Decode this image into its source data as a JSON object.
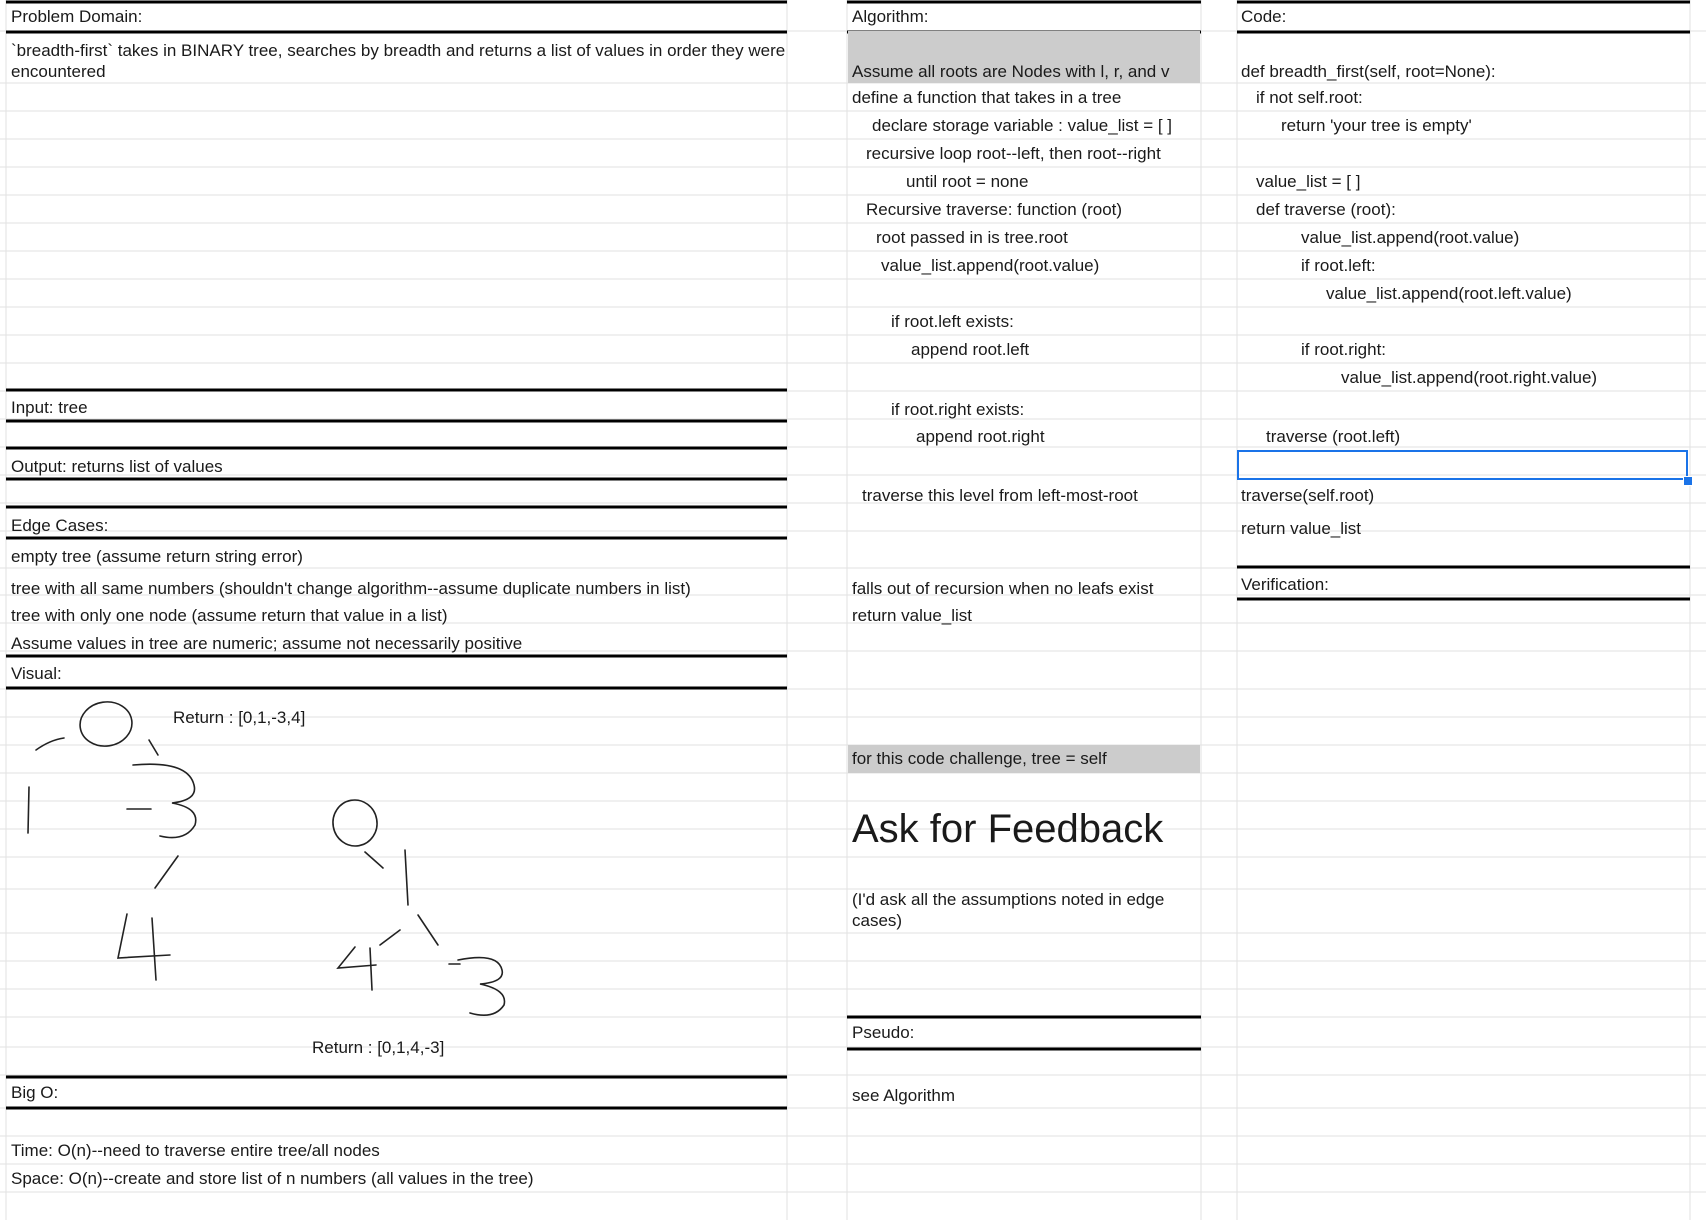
{
  "problem": {
    "header": "Problem Domain:",
    "text": "`breadth-first` takes in BINARY tree, searches by breadth and returns a list of values in order they were encountered",
    "input": "Input:  tree",
    "output": "Output: returns list of values",
    "edge_header": "Edge Cases:",
    "edge_cases": [
      "empty tree (assume return string error)",
      "tree with all same numbers (shouldn't change algorithm--assume duplicate numbers in list)",
      "tree with only one node (assume return that value in a list)",
      "Assume values in tree are numeric; assume not necessarily positive"
    ],
    "visual_header": "Visual:",
    "return1": "Return : [0,1,-3,4]",
    "return2": "Return : [0,1,4,-3]",
    "bigo_header": "Big O:",
    "time": "Time: O(n)--need to traverse entire tree/all nodes",
    "space": "Space: O(n)--create and store list of n numbers (all values in the tree)"
  },
  "algorithm": {
    "header": "Algorithm:",
    "lines": [
      "Assume all roots are Nodes with l, r, and v",
      "define a function that takes in a tree",
      "declare storage variable : value_list = [ ]",
      "recursive loop root--left, then root--right",
      "until root = none",
      "Recursive traverse: function (root)",
      "root passed in is tree.root",
      "value_list.append(root.value)",
      "if root.left exists:",
      "append root.left",
      "if root.right exists:",
      "append root.right",
      "traverse this level from left-most-root",
      "falls out of recursion when no leafs exist",
      "return value_list"
    ],
    "note": "for this code challenge, tree = self",
    "feedback": "Ask for Feedback",
    "feedback_note": "(I'd ask all the assumptions noted in edge cases)",
    "pseudo_header": "Pseudo:",
    "pseudo_text": "see Algorithm"
  },
  "code": {
    "header": "Code:",
    "lines": [
      "def breadth_first(self, root=None):",
      "if not self.root:",
      "return 'your tree is empty'",
      "value_list = [ ]",
      "def traverse (root):",
      "value_list.append(root.value)",
      "if root.left:",
      "value_list.append(root.left.value)",
      "if root.right:",
      "value_list.append(root.right.value)",
      "traverse (root.left)",
      "traverse(self.root)",
      "return value_list"
    ],
    "verification_header": "Verification:"
  },
  "colors": {
    "grid": "#e2e2e2",
    "border": "#000000",
    "shade": "#cccccc",
    "selection": "#1a73e8"
  }
}
